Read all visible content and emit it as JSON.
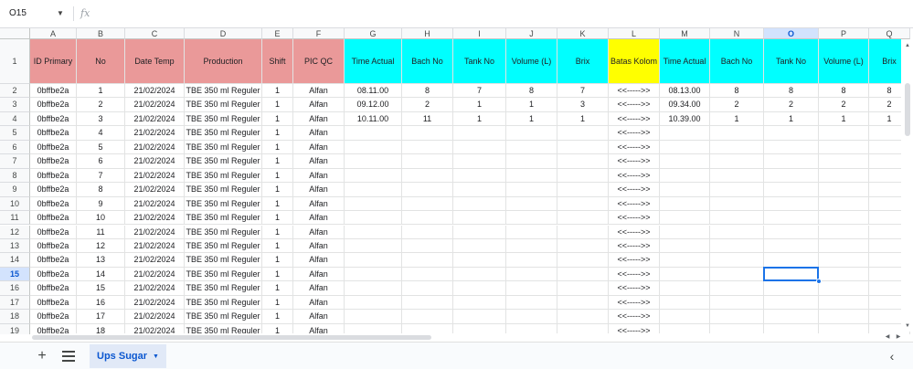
{
  "formula_bar": {
    "cell_ref": "O15",
    "fx_label": "fx",
    "value": ""
  },
  "columns": [
    "A",
    "B",
    "C",
    "D",
    "E",
    "F",
    "G",
    "H",
    "I",
    "J",
    "K",
    "L",
    "M",
    "N",
    "O",
    "P",
    "Q"
  ],
  "active_column": "O",
  "active_row": 15,
  "header_row": {
    "row_number": "1",
    "cells": [
      "ID Primary",
      "No",
      "Date Temp",
      "Production",
      "Shift",
      "PIC QC",
      "Time Actual",
      "Bach No",
      "Tank No",
      "Volume (L)",
      "Brix",
      "Batas Kolom",
      "Time Actual",
      "Bach No",
      "Tank No",
      "Volume (L)",
      "Brix"
    ],
    "fills": [
      "pink",
      "pink",
      "pink",
      "pink",
      "pink",
      "pink",
      "cyan",
      "cyan",
      "cyan",
      "cyan",
      "cyan",
      "yellow",
      "cyan",
      "cyan",
      "cyan",
      "cyan",
      "cyan"
    ]
  },
  "rows": [
    {
      "n": "2",
      "cells": [
        "0bffbe2a",
        "1",
        "21/02/2024",
        "TBE 350 ml Reguler",
        "1",
        "Alfan",
        "08.11.00",
        "8",
        "7",
        "8",
        "7",
        "<<----->>",
        "08.13.00",
        "8",
        "8",
        "8",
        "8"
      ]
    },
    {
      "n": "3",
      "cells": [
        "0bffbe2a",
        "2",
        "21/02/2024",
        "TBE 350 ml Reguler",
        "1",
        "Alfan",
        "09.12.00",
        "2",
        "1",
        "1",
        "3",
        "<<----->>",
        "09.34.00",
        "2",
        "2",
        "2",
        "2"
      ]
    },
    {
      "n": "4",
      "cells": [
        "0bffbe2a",
        "3",
        "21/02/2024",
        "TBE 350 ml Reguler",
        "1",
        "Alfan",
        "10.11.00",
        "11",
        "1",
        "1",
        "1",
        "<<----->>",
        "10.39.00",
        "1",
        "1",
        "1",
        "1"
      ]
    },
    {
      "n": "5",
      "cells": [
        "0bffbe2a",
        "4",
        "21/02/2024",
        "TBE 350 ml Reguler",
        "1",
        "Alfan",
        "",
        "",
        "",
        "",
        "",
        "<<----->>",
        "",
        "",
        "",
        "",
        ""
      ]
    },
    {
      "n": "6",
      "cells": [
        "0bffbe2a",
        "5",
        "21/02/2024",
        "TBE 350 ml Reguler",
        "1",
        "Alfan",
        "",
        "",
        "",
        "",
        "",
        "<<----->>",
        "",
        "",
        "",
        "",
        ""
      ]
    },
    {
      "n": "7",
      "cells": [
        "0bffbe2a",
        "6",
        "21/02/2024",
        "TBE 350 ml Reguler",
        "1",
        "Alfan",
        "",
        "",
        "",
        "",
        "",
        "<<----->>",
        "",
        "",
        "",
        "",
        ""
      ]
    },
    {
      "n": "8",
      "cells": [
        "0bffbe2a",
        "7",
        "21/02/2024",
        "TBE 350 ml Reguler",
        "1",
        "Alfan",
        "",
        "",
        "",
        "",
        "",
        "<<----->>",
        "",
        "",
        "",
        "",
        ""
      ]
    },
    {
      "n": "9",
      "cells": [
        "0bffbe2a",
        "8",
        "21/02/2024",
        "TBE 350 ml Reguler",
        "1",
        "Alfan",
        "",
        "",
        "",
        "",
        "",
        "<<----->>",
        "",
        "",
        "",
        "",
        ""
      ]
    },
    {
      "n": "10",
      "cells": [
        "0bffbe2a",
        "9",
        "21/02/2024",
        "TBE 350 ml Reguler",
        "1",
        "Alfan",
        "",
        "",
        "",
        "",
        "",
        "<<----->>",
        "",
        "",
        "",
        "",
        ""
      ]
    },
    {
      "n": "11",
      "cells": [
        "0bffbe2a",
        "10",
        "21/02/2024",
        "TBE 350 ml Reguler",
        "1",
        "Alfan",
        "",
        "",
        "",
        "",
        "",
        "<<----->>",
        "",
        "",
        "",
        "",
        ""
      ]
    },
    {
      "n": "12",
      "cells": [
        "0bffbe2a",
        "11",
        "21/02/2024",
        "TBE 350 ml Reguler",
        "1",
        "Alfan",
        "",
        "",
        "",
        "",
        "",
        "<<----->>",
        "",
        "",
        "",
        "",
        ""
      ]
    },
    {
      "n": "13",
      "cells": [
        "0bffbe2a",
        "12",
        "21/02/2024",
        "TBE 350 ml Reguler",
        "1",
        "Alfan",
        "",
        "",
        "",
        "",
        "",
        "<<----->>",
        "",
        "",
        "",
        "",
        ""
      ]
    },
    {
      "n": "14",
      "cells": [
        "0bffbe2a",
        "13",
        "21/02/2024",
        "TBE 350 ml Reguler",
        "1",
        "Alfan",
        "",
        "",
        "",
        "",
        "",
        "<<----->>",
        "",
        "",
        "",
        "",
        ""
      ]
    },
    {
      "n": "15",
      "cells": [
        "0bffbe2a",
        "14",
        "21/02/2024",
        "TBE 350 ml Reguler",
        "1",
        "Alfan",
        "",
        "",
        "",
        "",
        "",
        "<<----->>",
        "",
        "",
        "",
        "",
        ""
      ]
    },
    {
      "n": "16",
      "cells": [
        "0bffbe2a",
        "15",
        "21/02/2024",
        "TBE 350 ml Reguler",
        "1",
        "Alfan",
        "",
        "",
        "",
        "",
        "",
        "<<----->>",
        "",
        "",
        "",
        "",
        ""
      ]
    },
    {
      "n": "17",
      "cells": [
        "0bffbe2a",
        "16",
        "21/02/2024",
        "TBE 350 ml Reguler",
        "1",
        "Alfan",
        "",
        "",
        "",
        "",
        "",
        "<<----->>",
        "",
        "",
        "",
        "",
        ""
      ]
    },
    {
      "n": "18",
      "cells": [
        "0bffbe2a",
        "17",
        "21/02/2024",
        "TBE 350 ml Reguler",
        "1",
        "Alfan",
        "",
        "",
        "",
        "",
        "",
        "<<----->>",
        "",
        "",
        "",
        "",
        ""
      ]
    },
    {
      "n": "19",
      "cells": [
        "0bffbe2a",
        "18",
        "21/02/2024",
        "TBE 350 ml Reguler",
        "1",
        "Alfan",
        "",
        "",
        "",
        "",
        "",
        "<<----->>",
        "",
        "",
        "",
        "",
        ""
      ]
    }
  ],
  "sheet_bar": {
    "add_sheet_icon": "plus-icon",
    "all_sheets_icon": "menu-icon",
    "active_sheet": "Ups Sugar",
    "collapse_icon": "chevron-left-icon"
  },
  "colors": {
    "pink": "#ea9999",
    "cyan": "#00ffff",
    "yellow": "#ffff00",
    "selection": "#1a73e8"
  }
}
